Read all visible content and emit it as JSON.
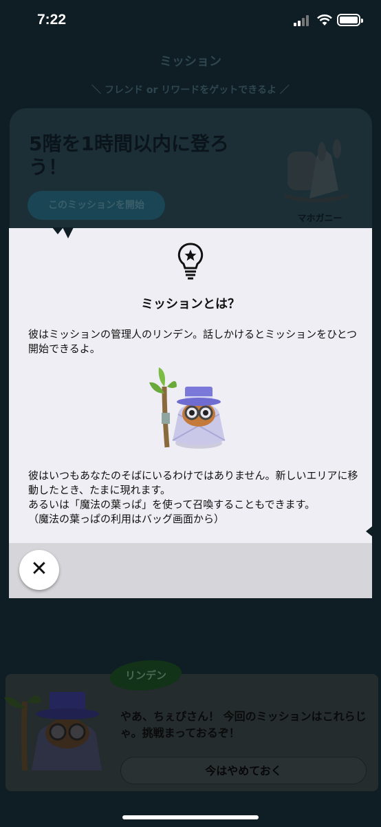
{
  "status_bar": {
    "time": "7:22"
  },
  "background": {
    "title": "ミッション",
    "subtitle": "＼ フレンド or リワードをゲットできるよ ／",
    "card": {
      "title": "5階を1時間以内に登ろう！",
      "start_button": "このミッションを開始",
      "reward_label": "マホガニー"
    }
  },
  "modal": {
    "heading": "ミッションとは？",
    "paragraph1": "彼はミッションの管理人のリンデン。話しかけるとミッションをひとつ開始できるよ。",
    "paragraph2": [
      "彼はいつもあなたのそばにいるわけではありません。新しいエリアに移動したとき、たまに現れます。",
      "あるいは「魔法の葉っぱ」を使って召喚することもできます。",
      "（魔法の葉っぱの利用はバッグ画面から）"
    ],
    "close_label": "✕"
  },
  "dialog": {
    "speaker": "リンデン",
    "message": "やあ、ちぇぴさん！ 今回のミッションはこれらじゃ。挑戦まっておるぞ！",
    "later_button": "今はやめておく"
  },
  "colors": {
    "overlay": "#0e1e24",
    "modal_bg": "#eeeef4",
    "modal_footer": "#d6d6da",
    "accent_teal": "#1a4554"
  }
}
